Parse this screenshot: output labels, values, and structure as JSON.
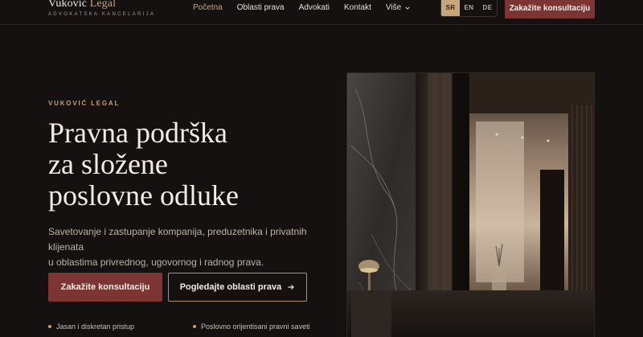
{
  "header": {
    "logo_name_main": "Vuković",
    "logo_name_accent": "Legal",
    "logo_tagline": "ADVOKATSKA KANCELARIJA",
    "nav": [
      {
        "label": "Početna",
        "active": true
      },
      {
        "label": "Oblasti prava",
        "active": false
      },
      {
        "label": "Advokati",
        "active": false
      },
      {
        "label": "Kontakt",
        "active": false
      },
      {
        "label": "Više",
        "active": false
      }
    ],
    "languages": [
      "SR",
      "EN",
      "DE"
    ],
    "active_language": "SR",
    "cta_label": "Zakažite konsultaciju"
  },
  "hero": {
    "eyebrow": "VUKOVIĆ LEGAL",
    "headline_lines": [
      "Pravna podrška",
      "za složene",
      "poslovne odluke"
    ],
    "lead_lines": [
      "Savetovanje i zastupanje kompanija, preduzetnika i privatnih klijenata",
      "u oblastima privrednog, ugovornog i radnog prava."
    ],
    "primary_button": "Zakažite konsultaciju",
    "secondary_button": "Pogledajte oblasti prava",
    "bullets": [
      "Jasan i diskretan pristup",
      "Poslovno orijentisani pravni saveti"
    ]
  },
  "icons": {
    "nav_more": "chevron-down-icon",
    "secondary_button": "arrow-right-icon"
  },
  "colors": {
    "background": "#141110",
    "accent_gold": "#c9a57b",
    "brand_burgundy": "#7c3533",
    "text_light": "#f2ece4"
  }
}
